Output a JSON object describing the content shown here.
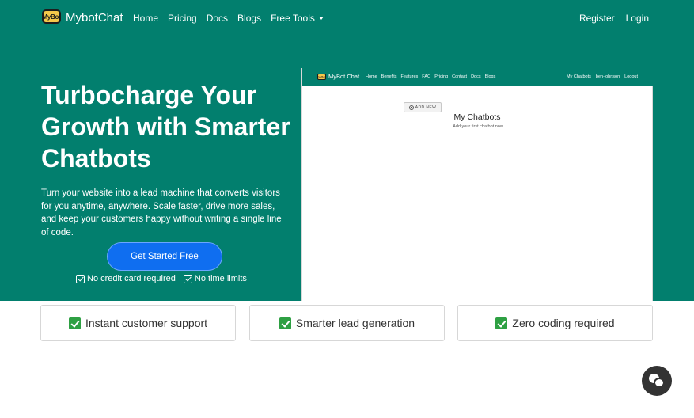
{
  "header": {
    "logo_text": "MyBot",
    "brand": "MybotChat",
    "nav": [
      "Home",
      "Pricing",
      "Docs",
      "Blogs",
      "Free Tools"
    ],
    "right": [
      "Register",
      "Login"
    ]
  },
  "hero": {
    "headline": "Turbocharge Your Growth with Smarter Chatbots",
    "subtext": "Turn your website into a lead machine that converts visitors for you anytime, anywhere. Scale faster, drive more sales, and keep your customers happy without writing a single line of code.",
    "cta_label": "Get Started Free",
    "checks": [
      "No credit card required",
      "No time limits"
    ]
  },
  "preview": {
    "logo_text": "MyBot",
    "brand": "MyBot.Chat",
    "nav": [
      "Home",
      "Benefits",
      "Features",
      "FAQ",
      "Pricing",
      "Contact",
      "Docs",
      "Blogs"
    ],
    "right": [
      "My Chatbots",
      "ben-johnson",
      "Logout"
    ],
    "add_button": "ADD NEW",
    "title": "My Chatbots",
    "subtitle": "Add your first chatbot now"
  },
  "features": [
    "Instant customer support",
    "Smarter lead generation",
    "Zero coding required"
  ],
  "colors": {
    "primary": "#027f6e",
    "cta": "#0f6ef0",
    "check": "#2ea043",
    "chat_button": "#333333"
  },
  "icons": {
    "chat": "chat-bubbles-icon",
    "check": "checkbox-icon",
    "dropdown": "caret-down-icon"
  }
}
